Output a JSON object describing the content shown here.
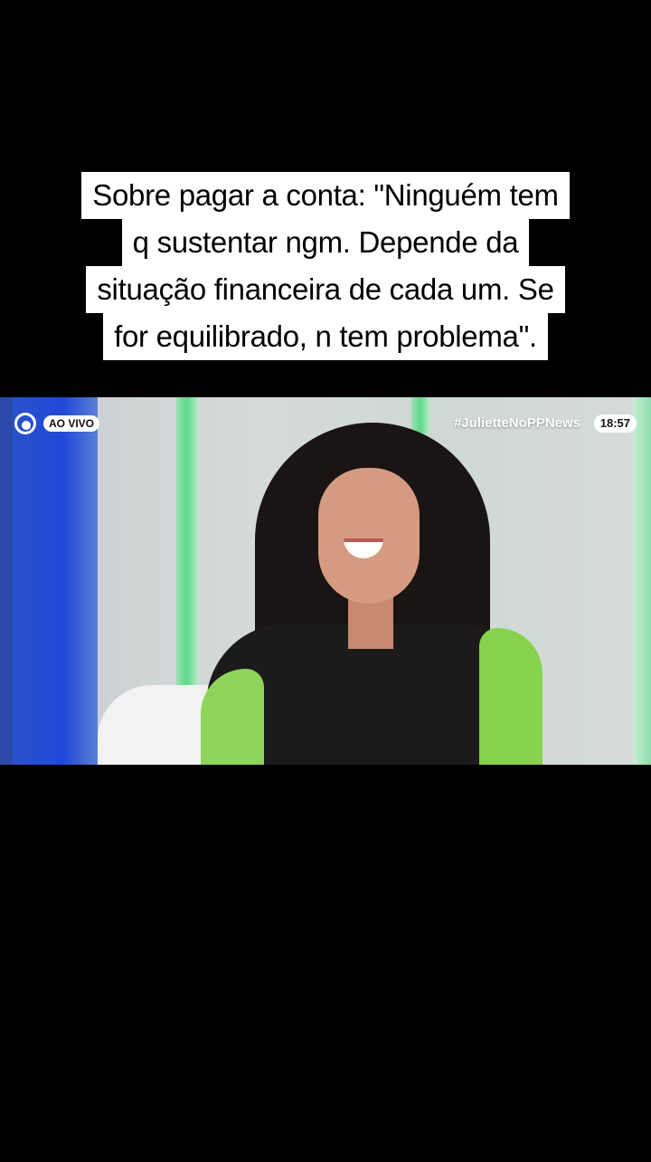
{
  "caption": {
    "lines": [
      "Sobre pagar a conta: \"Ninguém tem",
      "q sustentar ngm. Depende da",
      "situação financeira de cada um. Se",
      "for equilibrado, n tem problema\"."
    ]
  },
  "video": {
    "live_label": "AO VIVO",
    "hashtag": "#JulietteNoPPNews",
    "time": "18:57",
    "channel_logo_icon": "channel-logo-icon"
  },
  "colors": {
    "background": "#000000",
    "caption_bg": "#ffffff",
    "caption_text": "#000000",
    "accent_green": "#86d24f",
    "accent_blue": "#2048d8"
  }
}
